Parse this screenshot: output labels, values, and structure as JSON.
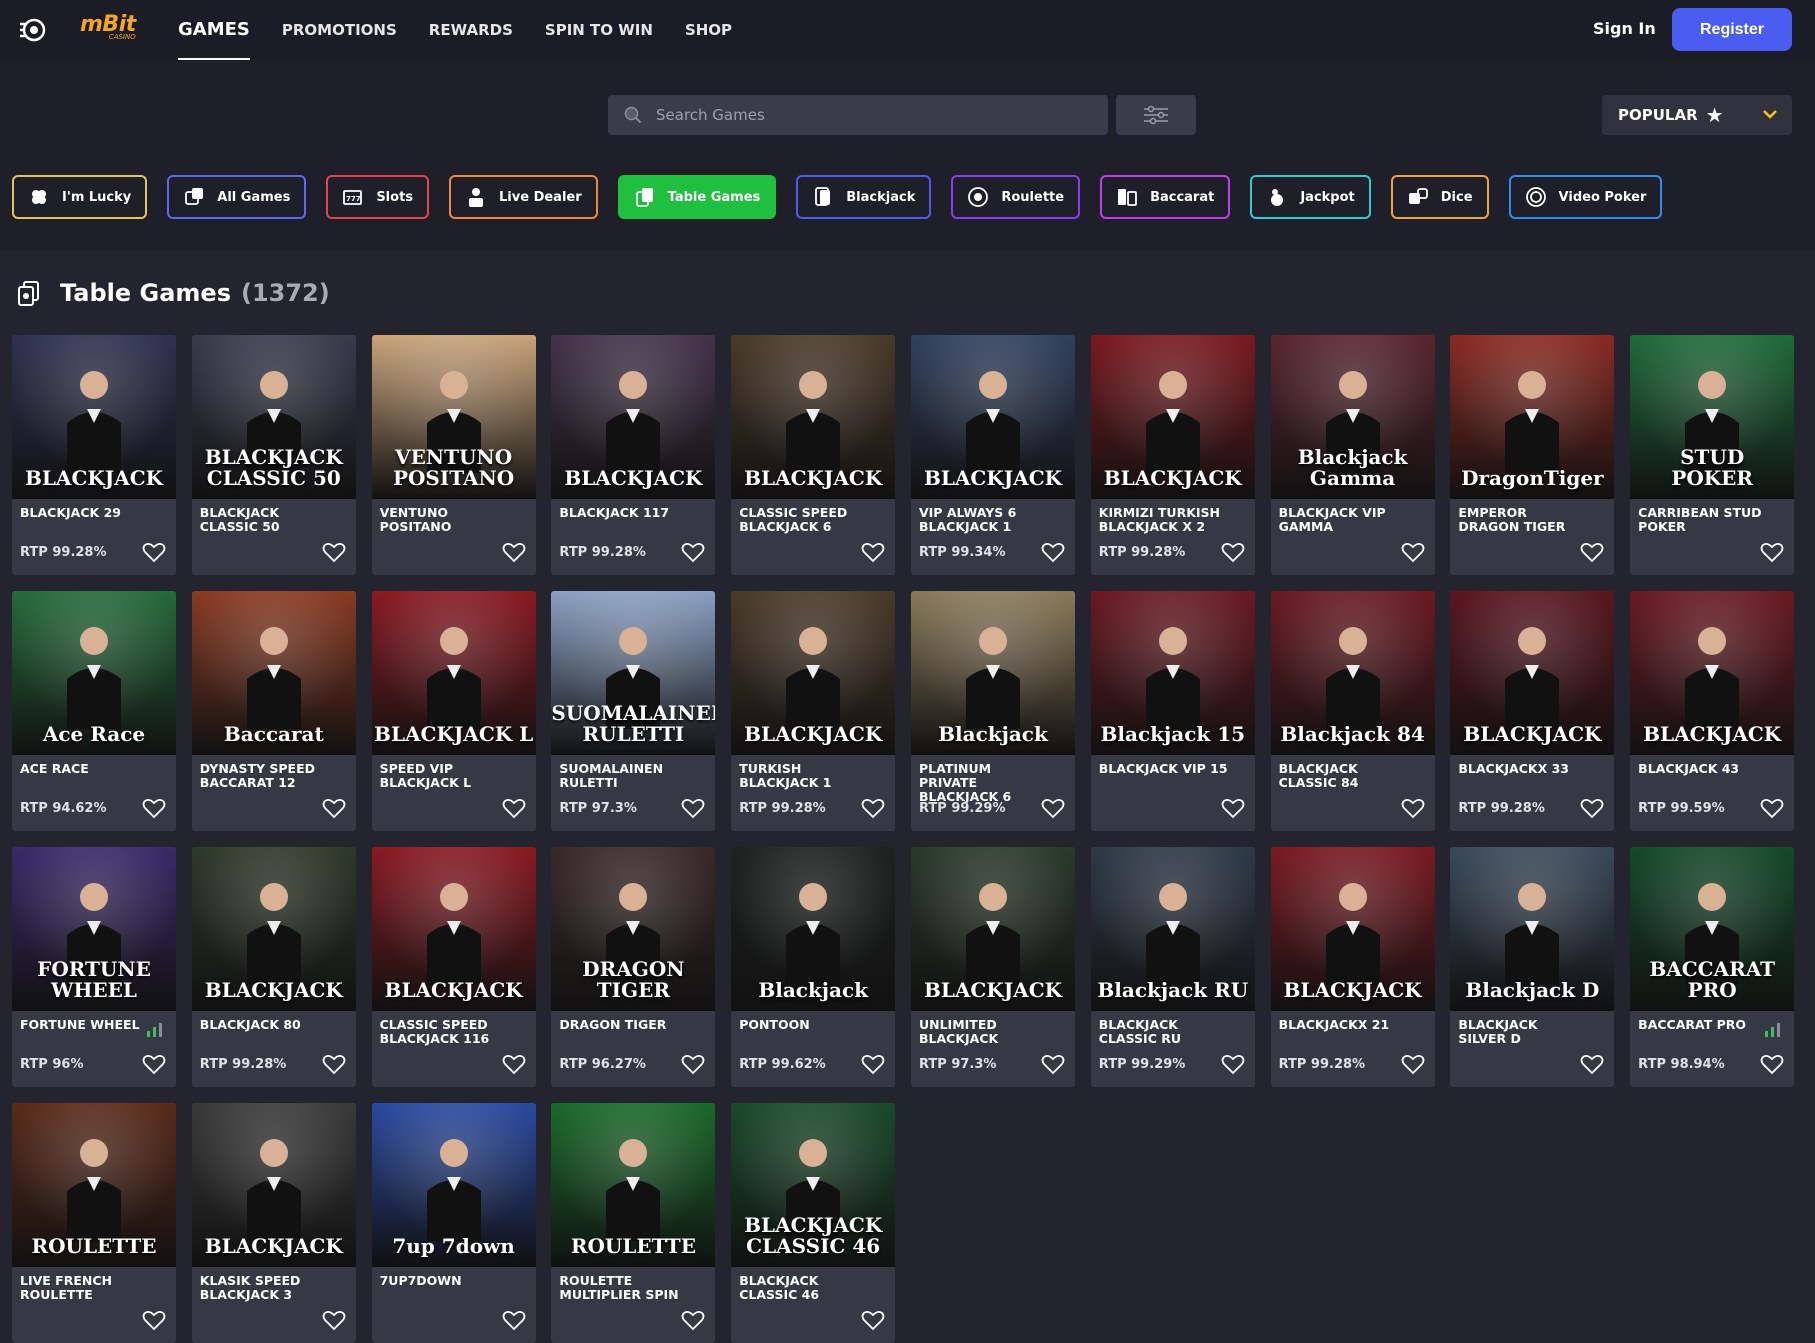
{
  "header": {
    "brand": "mBit",
    "brand_sub": "CASINO",
    "nav": [
      "GAMES",
      "PROMOTIONS",
      "REWARDS",
      "SPIN TO WIN",
      "SHOP"
    ],
    "sign_in": "Sign In",
    "register": "Register"
  },
  "search": {
    "placeholder": "Search Games"
  },
  "sort": {
    "label": "POPULAR"
  },
  "categories": [
    {
      "label": "I'm Lucky",
      "color": "#e3c35b",
      "icon": "clover-icon"
    },
    {
      "label": "All Games",
      "color": "#5a6bf0",
      "icon": "dice-icon"
    },
    {
      "label": "Slots",
      "color": "#e0464b",
      "icon": "slot-machine-icon"
    },
    {
      "label": "Live Dealer",
      "color": "#f08a3a",
      "icon": "live-dealer-icon"
    },
    {
      "label": "Table Games",
      "color": "#1fbf3f",
      "icon": "table-games-icon"
    },
    {
      "label": "Blackjack",
      "color": "#4b5cf0",
      "icon": "cards-icon"
    },
    {
      "label": "Roulette",
      "color": "#8a3cf0",
      "icon": "roulette-icon"
    },
    {
      "label": "Baccarat",
      "color": "#c43cf0",
      "icon": "baccarat-icon"
    },
    {
      "label": "Jackpot",
      "color": "#33c9d6",
      "icon": "jackpot-icon"
    },
    {
      "label": "Dice",
      "color": "#f0a53a",
      "icon": "dice-pair-icon"
    },
    {
      "label": "Video Poker",
      "color": "#2f8cf0",
      "icon": "chip-icon"
    }
  ],
  "section": {
    "title": "Table Games",
    "count": "(1372)"
  },
  "games": [
    {
      "name": "BLACKJACK 29",
      "rtp": "RTP 99.28%",
      "bg": "#2e3350",
      "art": "BLACKJACK"
    },
    {
      "name": "BLACKJACK CLASSIC 50",
      "rtp": "",
      "bg": "#383c4c",
      "art": "BLACKJACK\nCLASSIC 50"
    },
    {
      "name": "VENTUNO POSITANO",
      "rtp": "",
      "bg": "#c9a37a",
      "art": "VENTUNO\nPOSITANO"
    },
    {
      "name": "BLACKJACK 117",
      "rtp": "RTP 99.28%",
      "bg": "#44344a",
      "art": "BLACKJACK"
    },
    {
      "name": "CLASSIC SPEED BLACKJACK 6",
      "rtp": "",
      "bg": "#4a3a2a",
      "art": "BLACKJACK"
    },
    {
      "name": "VIP ALWAYS 6 BLACKJACK 1",
      "rtp": "RTP 99.34%",
      "bg": "#31415f",
      "art": "BLACKJACK"
    },
    {
      "name": "KIRMIZI TURKISH BLACKJACK X 2",
      "rtp": "RTP 99.28%",
      "bg": "#7a1a1f",
      "art": "BLACKJACK"
    },
    {
      "name": "BLACKJACK VIP GAMMA",
      "rtp": "",
      "bg": "#5a2630",
      "art": "Blackjack Gamma"
    },
    {
      "name": "EMPEROR DRAGON TIGER",
      "rtp": "",
      "bg": "#8a2a22",
      "art": "DragonTiger"
    },
    {
      "name": "CARRIBEAN STUD POKER",
      "rtp": "",
      "bg": "#1f6b3a",
      "art": "STUD\nPOKER"
    },
    {
      "name": "ACE RACE",
      "rtp": "RTP 94.62%",
      "bg": "#256b3a",
      "art": "Ace Race"
    },
    {
      "name": "DYNASTY SPEED BACCARAT 12",
      "rtp": "",
      "bg": "#8a3a22",
      "art": "Baccarat"
    },
    {
      "name": "SPEED VIP BLACKJACK L",
      "rtp": "",
      "bg": "#8a1a22",
      "art": "BLACKJACK L"
    },
    {
      "name": "SUOMALAINEN RULETTI",
      "rtp": "RTP 97.3%",
      "bg": "#8aa0c2",
      "art": "SUOMALAINEN RULETTI"
    },
    {
      "name": "TURKISH BLACKJACK 1",
      "rtp": "RTP 99.28%",
      "bg": "#4a3a2a",
      "art": "BLACKJACK"
    },
    {
      "name": "PLATINUM PRIVATE BLACKJACK 6",
      "rtp": "RTP 99.29%",
      "bg": "#8a7a5a",
      "art": "Blackjack"
    },
    {
      "name": "BLACKJACK VIP 15",
      "rtp": "",
      "bg": "#6a1a22",
      "art": "Blackjack 15"
    },
    {
      "name": "BLACKJACK CLASSIC 84",
      "rtp": "",
      "bg": "#6a1a22",
      "art": "Blackjack 84"
    },
    {
      "name": "BLACKJACKX 33",
      "rtp": "RTP 99.28%",
      "bg": "#5a1620",
      "art": "BLACKJACK"
    },
    {
      "name": "BLACKJACK 43",
      "rtp": "RTP 99.59%",
      "bg": "#6a1a22",
      "art": "BLACKJACK"
    },
    {
      "name": "FORTUNE WHEEL",
      "rtp": "RTP 96%",
      "bg": "#3a2a6a",
      "art": "FORTUNE\nWHEEL"
    },
    {
      "name": "BLACKJACK 80",
      "rtp": "RTP 99.28%",
      "bg": "#2e3a2a",
      "art": "BLACKJACK"
    },
    {
      "name": "CLASSIC SPEED BLACKJACK 116",
      "rtp": "",
      "bg": "#8a1a22",
      "art": "BLACKJACK"
    },
    {
      "name": "DRAGON TIGER",
      "rtp": "RTP 96.27%",
      "bg": "#3a2a2a",
      "art": "DRAGON\nTIGER"
    },
    {
      "name": "PONTOON",
      "rtp": "RTP 99.62%",
      "bg": "#1e2220",
      "art": "Blackjack"
    },
    {
      "name": "UNLIMITED BLACKJACK",
      "rtp": "RTP 97.3%",
      "bg": "#2a3a2a",
      "art": "BLACKJACK"
    },
    {
      "name": "BLACKJACK CLASSIC RU",
      "rtp": "RTP 99.29%",
      "bg": "#2e3a48",
      "art": "Blackjack RU"
    },
    {
      "name": "BLACKJACKX 21",
      "rtp": "RTP 99.28%",
      "bg": "#7a1a22",
      "art": "BLACKJACK"
    },
    {
      "name": "BLACKJACK SILVER D",
      "rtp": "",
      "bg": "#3a4a5a",
      "art": "Blackjack D"
    },
    {
      "name": "BACCARAT PRO",
      "rtp": "RTP 98.94%",
      "bg": "#154a2a",
      "art": "BACCARAT\nPRO"
    },
    {
      "name": "LIVE FRENCH ROULETTE",
      "rtp": "",
      "bg": "#5a2a1a",
      "art": "ROULETTE"
    },
    {
      "name": "KLASIK SPEED BLACKJACK 3",
      "rtp": "",
      "bg": "#3a3a3a",
      "art": "BLACKJACK"
    },
    {
      "name": "7UP7DOWN",
      "rtp": "",
      "bg": "#2a4aa0",
      "art": "7up 7down"
    },
    {
      "name": "ROULETTE MULTIPLIER SPIN",
      "rtp": "",
      "bg": "#1a6a2a",
      "art": "ROULETTE"
    },
    {
      "name": "BLACKJACK CLASSIC 46",
      "rtp": "",
      "bg": "#1a4a2a",
      "art": "BLACKJACK\nCLASSIC 46"
    }
  ],
  "bars_cards": [
    20,
    29
  ]
}
